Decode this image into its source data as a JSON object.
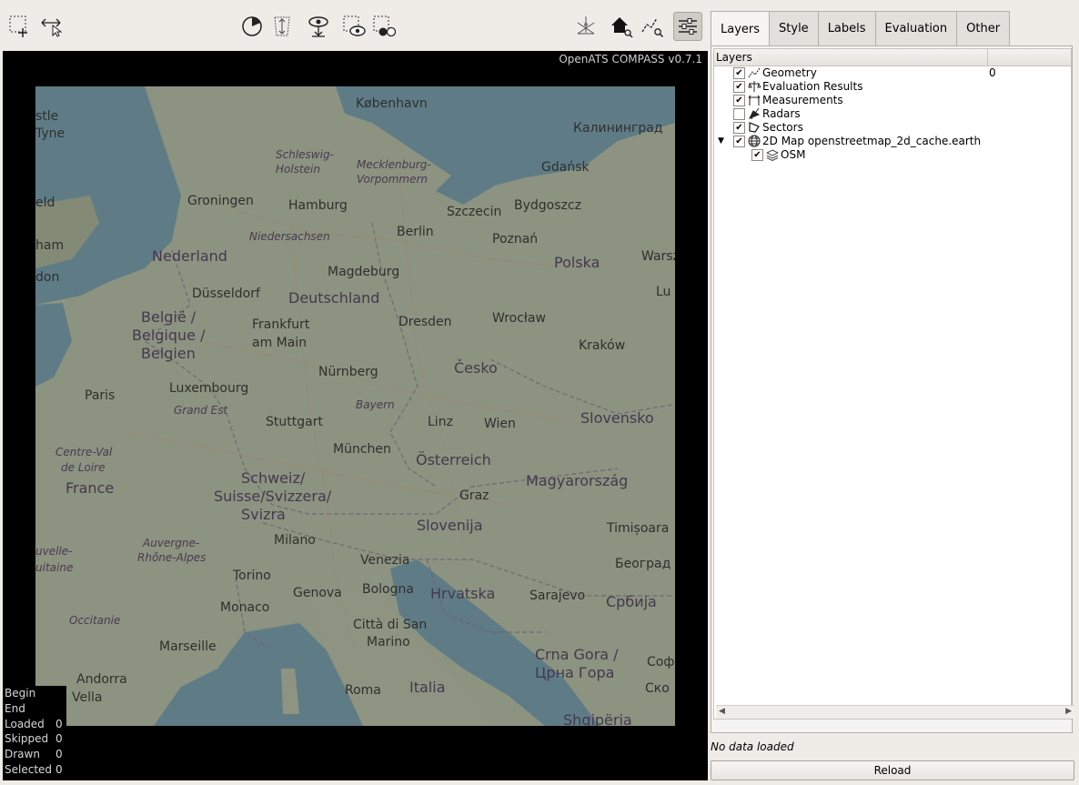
{
  "app_version": "OpenATS COMPASS v0.7.1",
  "toolbar": {
    "buttons": [
      {
        "name": "select-rect-add-icon"
      },
      {
        "name": "select-rect-pan-icon"
      },
      {
        "name": "time-filter-icon"
      },
      {
        "name": "height-filter-icon"
      },
      {
        "name": "show-data-icon"
      },
      {
        "name": "select-view-icon"
      },
      {
        "name": "select-compare-icon"
      },
      {
        "name": "3d-view-icon"
      },
      {
        "name": "home-zoom-icon"
      },
      {
        "name": "zoom-to-data-icon"
      },
      {
        "name": "settings-sliders-icon"
      }
    ]
  },
  "map": {
    "labels": [
      {
        "t": "København",
        "k": "city"
      },
      {
        "t": "Калининград",
        "k": "city"
      },
      {
        "t": "stle",
        "k": "city"
      },
      {
        "t": "Tyne",
        "k": "city"
      },
      {
        "t": "Schleswig-",
        "k": "region"
      },
      {
        "t": "Holstein",
        "k": "region"
      },
      {
        "t": "Mecklenburg-",
        "k": "region"
      },
      {
        "t": "Vorpommern",
        "k": "region"
      },
      {
        "t": "Gdańsk",
        "k": "city"
      },
      {
        "t": "eld",
        "k": "city"
      },
      {
        "t": "Groningen",
        "k": "city"
      },
      {
        "t": "Hamburg",
        "k": "city"
      },
      {
        "t": "Szczecin",
        "k": "city"
      },
      {
        "t": "Bydgoszcz",
        "k": "city"
      },
      {
        "t": "Berlin",
        "k": "city"
      },
      {
        "t": "Poznań",
        "k": "city"
      },
      {
        "t": "Niedersachsen",
        "k": "region"
      },
      {
        "t": "ham",
        "k": "city"
      },
      {
        "t": "Nederland",
        "k": "country"
      },
      {
        "t": "Polska",
        "k": "country"
      },
      {
        "t": "Warsz",
        "k": "city"
      },
      {
        "t": "don",
        "k": "city"
      },
      {
        "t": "Magdeburg",
        "k": "city"
      },
      {
        "t": "Düsseldorf",
        "k": "city"
      },
      {
        "t": "Deutschland",
        "k": "country"
      },
      {
        "t": "Lu",
        "k": "city"
      },
      {
        "t": "België /",
        "k": "country"
      },
      {
        "t": "Belgique /",
        "k": "country"
      },
      {
        "t": "Belgien",
        "k": "country"
      },
      {
        "t": "Frankfurt",
        "k": "city"
      },
      {
        "t": "am Main",
        "k": "city"
      },
      {
        "t": "Dresden",
        "k": "city"
      },
      {
        "t": "Wrocław",
        "k": "city"
      },
      {
        "t": "Kraków",
        "k": "city"
      },
      {
        "t": "Nürnberg",
        "k": "city"
      },
      {
        "t": "Česko",
        "k": "country"
      },
      {
        "t": "Luxembourg",
        "k": "city"
      },
      {
        "t": "Paris",
        "k": "city"
      },
      {
        "t": "Bayern",
        "k": "region"
      },
      {
        "t": "Grand Est",
        "k": "region"
      },
      {
        "t": "Linz",
        "k": "city"
      },
      {
        "t": "Wien",
        "k": "city"
      },
      {
        "t": "Slovensko",
        "k": "country"
      },
      {
        "t": "Stuttgart",
        "k": "city"
      },
      {
        "t": "München",
        "k": "city"
      },
      {
        "t": "Centre-Val",
        "k": "region"
      },
      {
        "t": "de Loire",
        "k": "region"
      },
      {
        "t": "Österreich",
        "k": "country"
      },
      {
        "t": "France",
        "k": "country"
      },
      {
        "t": "Schweiz/",
        "k": "country"
      },
      {
        "t": "Suisse/Svizzera/",
        "k": "country"
      },
      {
        "t": "Svizra",
        "k": "country"
      },
      {
        "t": "Graz",
        "k": "city"
      },
      {
        "t": "Magyarország",
        "k": "country"
      },
      {
        "t": "Slovenija",
        "k": "country"
      },
      {
        "t": "Timișoara",
        "k": "city"
      },
      {
        "t": "Auvergne-",
        "k": "region"
      },
      {
        "t": "Rhône-Alpes",
        "k": "region"
      },
      {
        "t": "Milano",
        "k": "city"
      },
      {
        "t": "uvelle-",
        "k": "region"
      },
      {
        "t": "uitaine",
        "k": "region"
      },
      {
        "t": "Venezia",
        "k": "city"
      },
      {
        "t": "Београд",
        "k": "city"
      },
      {
        "t": "Torino",
        "k": "city"
      },
      {
        "t": "Hrvatska",
        "k": "country"
      },
      {
        "t": "Genova",
        "k": "city"
      },
      {
        "t": "Bologna",
        "k": "city"
      },
      {
        "t": "Sarajevo",
        "k": "city"
      },
      {
        "t": "Србија",
        "k": "country"
      },
      {
        "t": "Monaco",
        "k": "city"
      },
      {
        "t": "Occitanie",
        "k": "region"
      },
      {
        "t": "Città di San",
        "k": "city"
      },
      {
        "t": "Marino",
        "k": "city"
      },
      {
        "t": "Marseille",
        "k": "city"
      },
      {
        "t": "Crna Gora /",
        "k": "country"
      },
      {
        "t": "Црна Гора",
        "k": "country"
      },
      {
        "t": "Andorra",
        "k": "city"
      },
      {
        "t": "Vella",
        "k": "city"
      },
      {
        "t": "Roma",
        "k": "city"
      },
      {
        "t": "Italia",
        "k": "country"
      },
      {
        "t": "Shqipëria",
        "k": "country"
      },
      {
        "t": "Соф",
        "k": "city"
      },
      {
        "t": "Ско",
        "k": "city"
      }
    ]
  },
  "stats": [
    {
      "label": "Begin",
      "value": ""
    },
    {
      "label": "End",
      "value": ""
    },
    {
      "label": "Loaded",
      "value": "0"
    },
    {
      "label": "Skipped",
      "value": "0"
    },
    {
      "label": "Drawn",
      "value": "0"
    },
    {
      "label": "Selected",
      "value": "0"
    }
  ],
  "tabs": [
    "Layers",
    "Style",
    "Labels",
    "Evaluation",
    "Other"
  ],
  "layers": {
    "header": "Layers",
    "header_col2": "",
    "rows": [
      {
        "label": "Geometry",
        "checked": true,
        "icon": "geometry-icon",
        "count": "0"
      },
      {
        "label": "Evaluation Results",
        "checked": true,
        "icon": "evaluation-icon",
        "count": ""
      },
      {
        "label": "Measurements",
        "checked": true,
        "icon": "measurement-icon",
        "count": ""
      },
      {
        "label": "Radars",
        "checked": false,
        "icon": "radar-icon",
        "count": ""
      },
      {
        "label": "Sectors",
        "checked": true,
        "icon": "sector-icon",
        "count": ""
      },
      {
        "label": "2D Map openstreetmap_2d_cache.earth",
        "checked": true,
        "icon": "globe-icon",
        "count": "",
        "expanded": true
      },
      {
        "label": "OSM",
        "checked": true,
        "icon": "layers-icon",
        "count": "",
        "child": true
      }
    ]
  },
  "status_text": "No data loaded",
  "reload_label": "Reload"
}
